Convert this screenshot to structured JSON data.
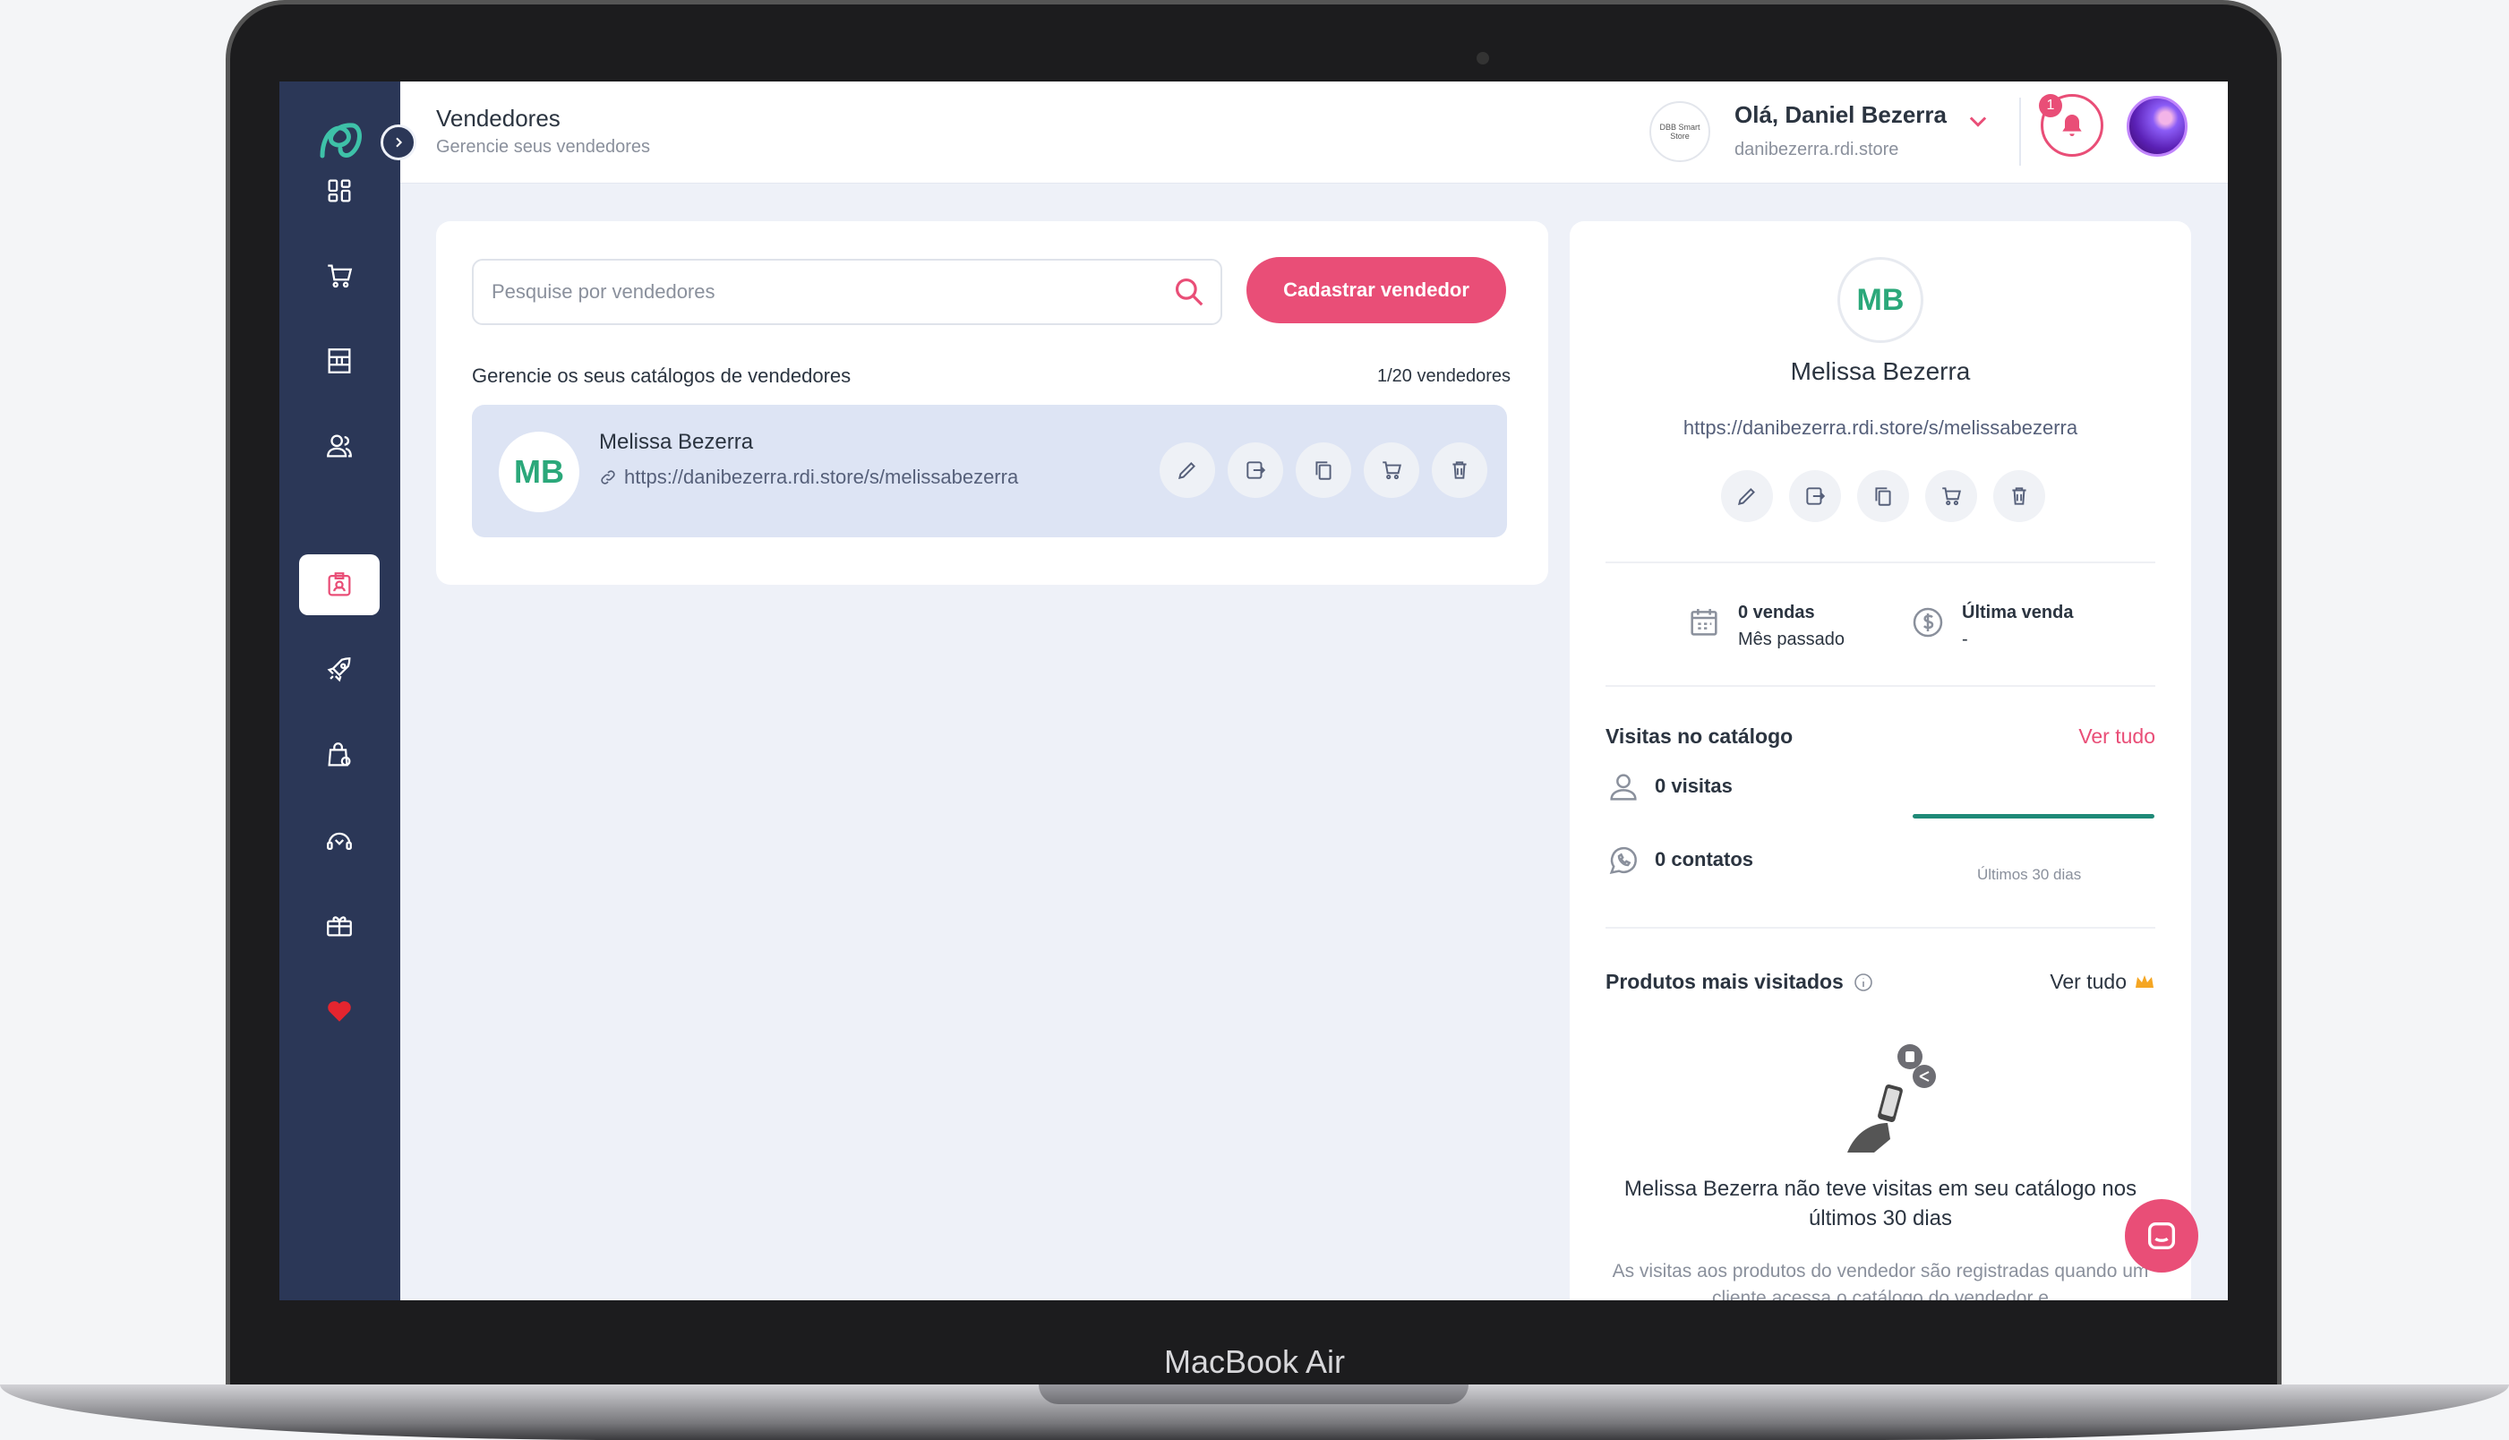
{
  "device_label": "MacBook Air",
  "header": {
    "title": "Vendedores",
    "subtitle": "Gerencie seus vendedores",
    "greeting": "Olá, Daniel Bezerra",
    "store_domain": "danibezerra.rdi.store",
    "store_logo_text": "DBB Smart Store",
    "notification_count": "1"
  },
  "sidebar": {
    "items": [
      {
        "icon": "dashboard-icon"
      },
      {
        "icon": "cart-icon"
      },
      {
        "icon": "catalog-icon"
      },
      {
        "icon": "customers-icon"
      },
      {
        "icon": "sellers-icon",
        "active": true
      },
      {
        "icon": "rocket-icon"
      },
      {
        "icon": "shopping-bag-settings-icon"
      },
      {
        "icon": "support-icon"
      },
      {
        "icon": "gift-icon"
      },
      {
        "icon": "heart-icon"
      }
    ]
  },
  "sellers": {
    "search_placeholder": "Pesquise por vendedores",
    "add_button": "Cadastrar vendedor",
    "manage_label": "Gerencie os seus catálogos de vendedores",
    "count_label": "1/20 vendedores",
    "rows": [
      {
        "initials": "MB",
        "name": "Melissa Bezerra",
        "url": "https://danibezerra.rdi.store/s/melissabezerra"
      }
    ]
  },
  "detail": {
    "initials": "MB",
    "name": "Melissa Bezerra",
    "url": "https://danibezerra.rdi.store/s/melissabezerra",
    "sales_count": "0 vendas",
    "sales_period": "Mês passado",
    "last_sale_label": "Última venda",
    "last_sale_value": "-",
    "visits_title": "Visitas no catálogo",
    "see_all": "Ver tudo",
    "visits": "0 visitas",
    "contacts": "0 contatos",
    "period": "Últimos 30 dias",
    "products_title": "Produtos mais visitados",
    "products_see_all": "Ver tudo",
    "empty_title": "Melissa Bezerra não teve visitas em seu catálogo nos últimos 30 dias",
    "empty_subtitle": "As visitas aos produtos do vendedor são registradas quando um cliente acessa o catálogo do vendedor e"
  },
  "colors": {
    "accent": "#e94e77",
    "sidebar": "#2b3757",
    "initials": "#2ba87a",
    "spark": "#1f8a78"
  }
}
